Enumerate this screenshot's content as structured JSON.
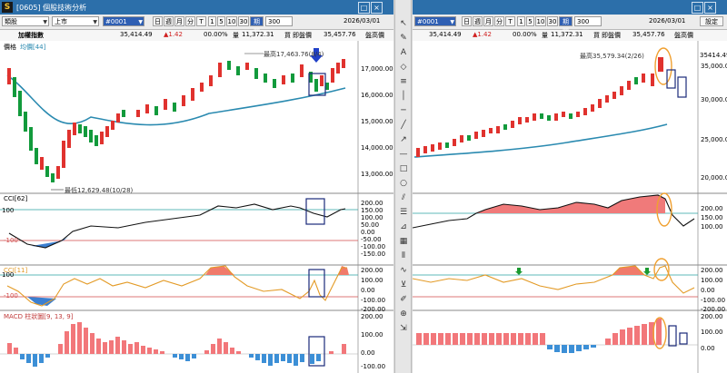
{
  "left": {
    "title": "[0605] 個股技術分析",
    "market_select": "類股",
    "exchange_select": "上市",
    "symbol_select": "#0001",
    "period_buttons": [
      "日",
      "週",
      "月",
      "分",
      "T"
    ],
    "minute_buttons": [
      "1",
      "5",
      "10",
      "30"
    ],
    "period_label": "期間",
    "count_value": "300",
    "date_value": "2026/03/01",
    "settings_label": "設定",
    "quote": {
      "name": "加權指數",
      "price": "35,414.49",
      "change": "▲1.42",
      "pct": "00.00%",
      "vol_label": "量",
      "vol": "11,372.31",
      "board_label": "買",
      "board_value": "即盤價",
      "ask": "35,457.76",
      "ask_label": "賣價",
      "extra": "盤高價"
    },
    "price_panel_label": "價格",
    "ma_label": "均價[44]",
    "high_annotation": "最高17,463.76(8/4)",
    "low_annotation": "最低12,629.48(10/28)",
    "price_axis": [
      "17,000.00",
      "16,000.00",
      "15,000.00",
      "14,000.00",
      "13,000.00"
    ],
    "cci1_label": "CCI[62]",
    "cci1_axis": [
      "200.00",
      "150.00",
      "100.00",
      "50.00",
      "0.00",
      "-50.00",
      "-100.00",
      "-150.00"
    ],
    "cci2_label": "CCI[11]",
    "cci2_axis": [
      "200.00",
      "100.00",
      "0.00",
      "-100.00",
      "-200.00"
    ],
    "macd_label": "MACD 柱狀圖[9, 13, 9]",
    "macd_axis": [
      "200.00",
      "100.00",
      "0.00",
      "-100.00"
    ],
    "cci_markers": [
      "100",
      "-100"
    ]
  },
  "right": {
    "title": "",
    "symbol_select": "#0001",
    "period_buttons": [
      "日",
      "週",
      "月",
      "分",
      "T"
    ],
    "minute_buttons": [
      "1",
      "5",
      "10",
      "30"
    ],
    "period_label": "期間",
    "count_value": "300",
    "date_value": "2026/03/01",
    "settings_label": "設定",
    "quote": {
      "price": "35,414.49",
      "change": "▲1.42",
      "pct": "00.00%",
      "vol_label": "量",
      "vol": "11,372.31",
      "board_label": "買",
      "board_value": "即盤價",
      "ask": "35,457.76",
      "extra": "盤高價"
    },
    "high_annotation": "最高35,579.34(2/26)",
    "last_price": "35414.49",
    "price_axis": [
      "35,000.00",
      "30,000.00",
      "25,000.00",
      "20,000.00"
    ],
    "cci1_axis": [
      "200.00",
      "150.00",
      "100.00"
    ],
    "cci2_axis": [
      "200.00",
      "100.00",
      "0.00",
      "-100.00",
      "-200.00"
    ],
    "macd_axis": [
      "200.00",
      "100.00",
      "0.00"
    ]
  },
  "tools": [
    "cursor-icon",
    "draw-icon",
    "text-icon",
    "eraser-icon",
    "menu-icon",
    "line-icon",
    "hline-icon",
    "diag-line-icon",
    "arrow-icon",
    "dash-icon",
    "rect-icon",
    "ellipse-icon",
    "channel-icon",
    "fib-icon",
    "gann-icon",
    "grid-icon",
    "cycle-icon",
    "wave-icon",
    "speed-icon",
    "pencil-icon",
    "zoom-icon",
    "expand-icon"
  ],
  "colors": {
    "up": "#e0322e",
    "down": "#129a3c",
    "ma": "#2a8ab0",
    "cci_line": "#e39a25",
    "macd_up": "#f2777a",
    "macd_down": "#3c8fd6",
    "annot_box": "#1a2a7a",
    "circle": "#f0a030"
  }
}
